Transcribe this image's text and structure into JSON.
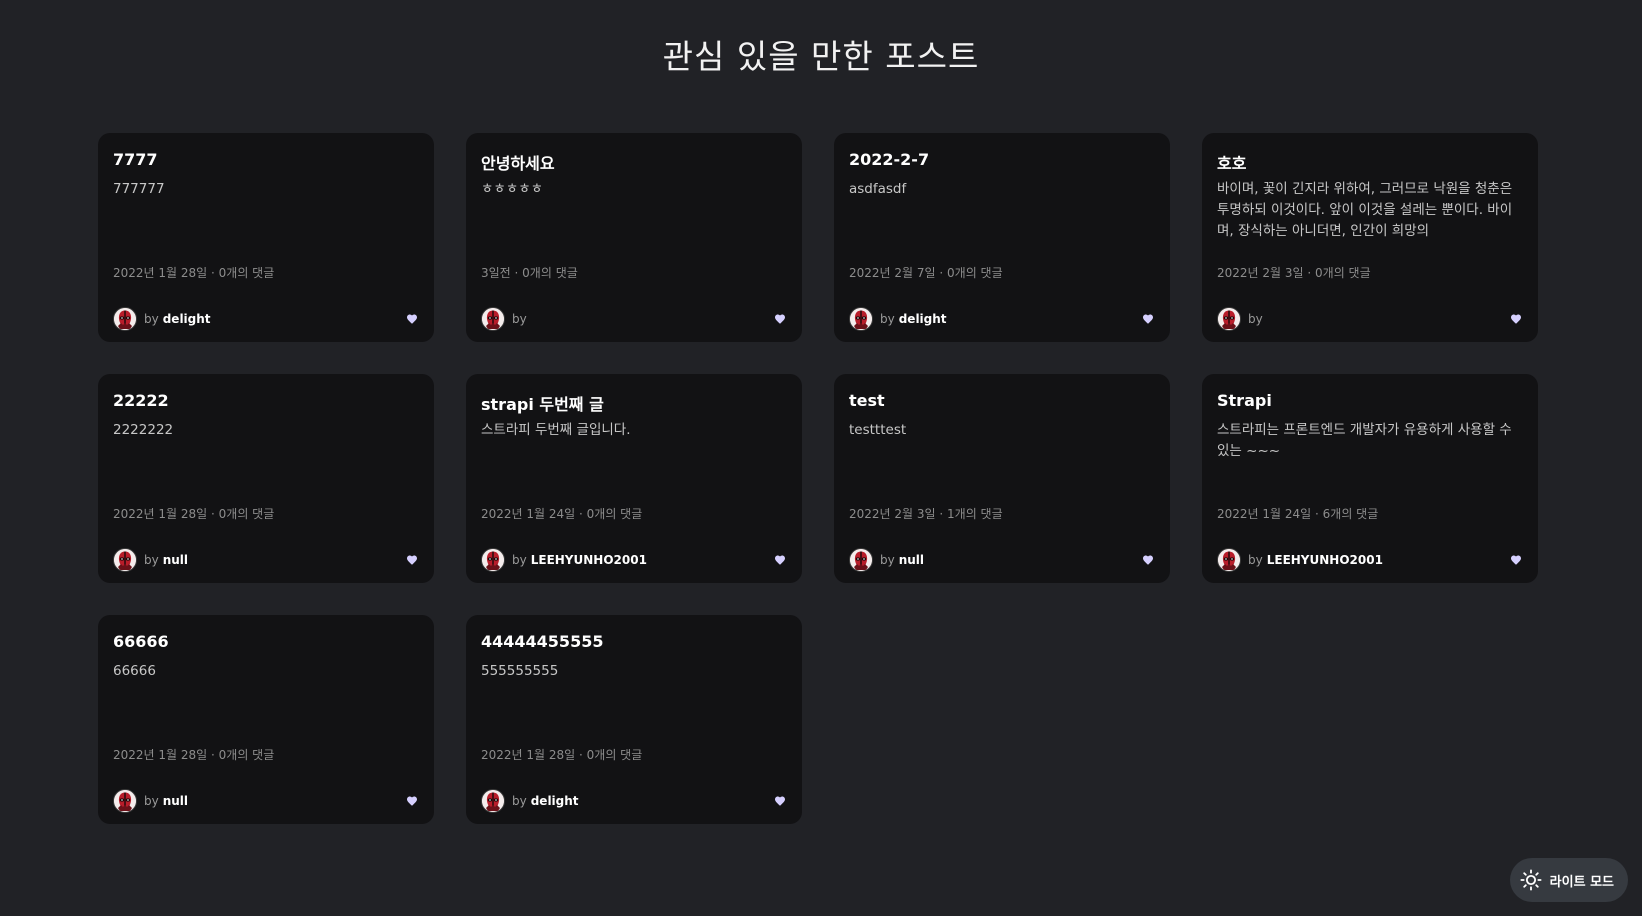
{
  "page": {
    "title": "관심 있을 만한 포스트"
  },
  "posts": [
    {
      "title": "7777",
      "description": "777777",
      "date": "2022년 1월 28일",
      "comments": "0개의 댓글",
      "by": "by",
      "author": "delight"
    },
    {
      "title": "안녕하세요",
      "description": "ㅎㅎㅎㅎㅎ",
      "date": "3일전",
      "comments": "0개의 댓글",
      "by": "by",
      "author": ""
    },
    {
      "title": "2022-2-7",
      "description": "asdfasdf",
      "date": "2022년 2월 7일",
      "comments": "0개의 댓글",
      "by": "by",
      "author": "delight"
    },
    {
      "title": "호호",
      "description": "바이며, 꽃이 긴지라 위하여, 그러므로 낙원을 청춘은 투명하되 이것이다. 앞이 이것을 설레는 뿐이다. 바이며, 장식하는 아니더면, 인간이 희망의",
      "date": "2022년 2월 3일",
      "comments": "0개의 댓글",
      "by": "by",
      "author": ""
    },
    {
      "title": "22222",
      "description": "2222222",
      "date": "2022년 1월 28일",
      "comments": "0개의 댓글",
      "by": "by",
      "author": "null"
    },
    {
      "title": "strapi 두번째 글",
      "description": "스트라피 두번째 글입니다.",
      "date": "2022년 1월 24일",
      "comments": "0개의 댓글",
      "by": "by",
      "author": "LEEHYUNHO2001"
    },
    {
      "title": "test",
      "description": "testttest",
      "date": "2022년 2월 3일",
      "comments": "1개의 댓글",
      "by": "by",
      "author": "null"
    },
    {
      "title": "Strapi",
      "description": "스트라피는 프론트엔드 개발자가 유용하게 사용할 수 있는 ~~~",
      "date": "2022년 1월 24일",
      "comments": "6개의 댓글",
      "by": "by",
      "author": "LEEHYUNHO2001"
    },
    {
      "title": "66666",
      "description": "66666",
      "date": "2022년 1월 28일",
      "comments": "0개의 댓글",
      "by": "by",
      "author": "null"
    },
    {
      "title": "44444455555",
      "description": "555555555",
      "date": "2022년 1월 28일",
      "comments": "0개의 댓글",
      "by": "by",
      "author": "delight"
    }
  ],
  "meta_separator": " · ",
  "icons": {
    "avatar": "deadpool-avatar-icon",
    "like": "heart-icon",
    "theme": "sun-icon"
  },
  "colors": {
    "background": "#212226",
    "card": "#121214",
    "heart": "#d6d0ff",
    "toggle": "#363a40"
  },
  "theme_toggle": {
    "label": "라이트 모드"
  }
}
